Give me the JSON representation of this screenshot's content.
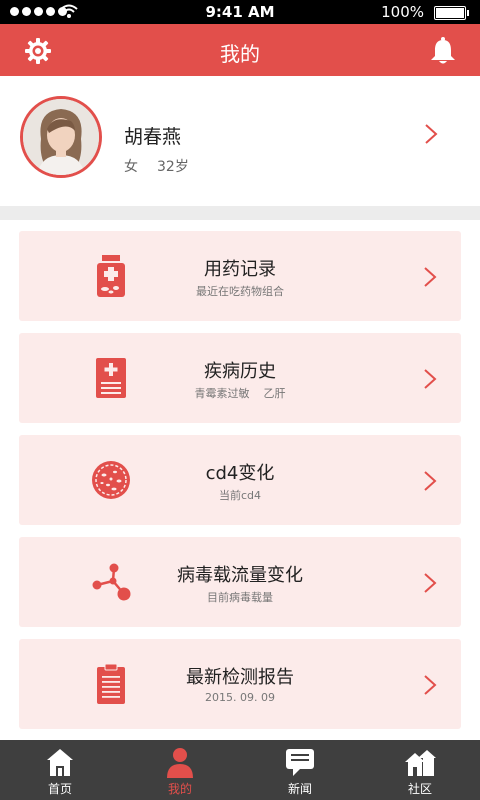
{
  "status_bar": {
    "time": "9:41 AM",
    "battery": "100%"
  },
  "header": {
    "title": "我的",
    "settings_icon": "gear-icon",
    "notification_icon": "bell-icon",
    "color": "#e24f4b"
  },
  "profile": {
    "name": "胡春燕",
    "gender": "女",
    "age": "32岁"
  },
  "menu": [
    {
      "title": "用药记录",
      "subtitle": [
        "最近在吃药物组合"
      ],
      "icon": "medicine-bottle-icon"
    },
    {
      "title": "疾病历史",
      "subtitle": [
        "青霉素过敏",
        "乙肝"
      ],
      "icon": "medical-record-icon"
    },
    {
      "title": "cd4变化",
      "subtitle": [
        "当前cd4"
      ],
      "icon": "cell-icon"
    },
    {
      "title": "病毒载流量变化",
      "subtitle": [
        "目前病毒载量"
      ],
      "icon": "molecule-icon"
    },
    {
      "title": "最新检测报告",
      "subtitle": [
        "2015. 09. 09"
      ],
      "icon": "clipboard-icon"
    }
  ],
  "tabs": [
    {
      "label": "首页",
      "icon": "home-icon"
    },
    {
      "label": "我的",
      "icon": "user-icon",
      "active": true
    },
    {
      "label": "新闻",
      "icon": "chat-icon"
    },
    {
      "label": "社区",
      "icon": "community-icon"
    }
  ],
  "colors": {
    "accent": "#e24f4b",
    "card_bg": "#fcebea",
    "tabbar_bg": "#3f3f3f"
  }
}
